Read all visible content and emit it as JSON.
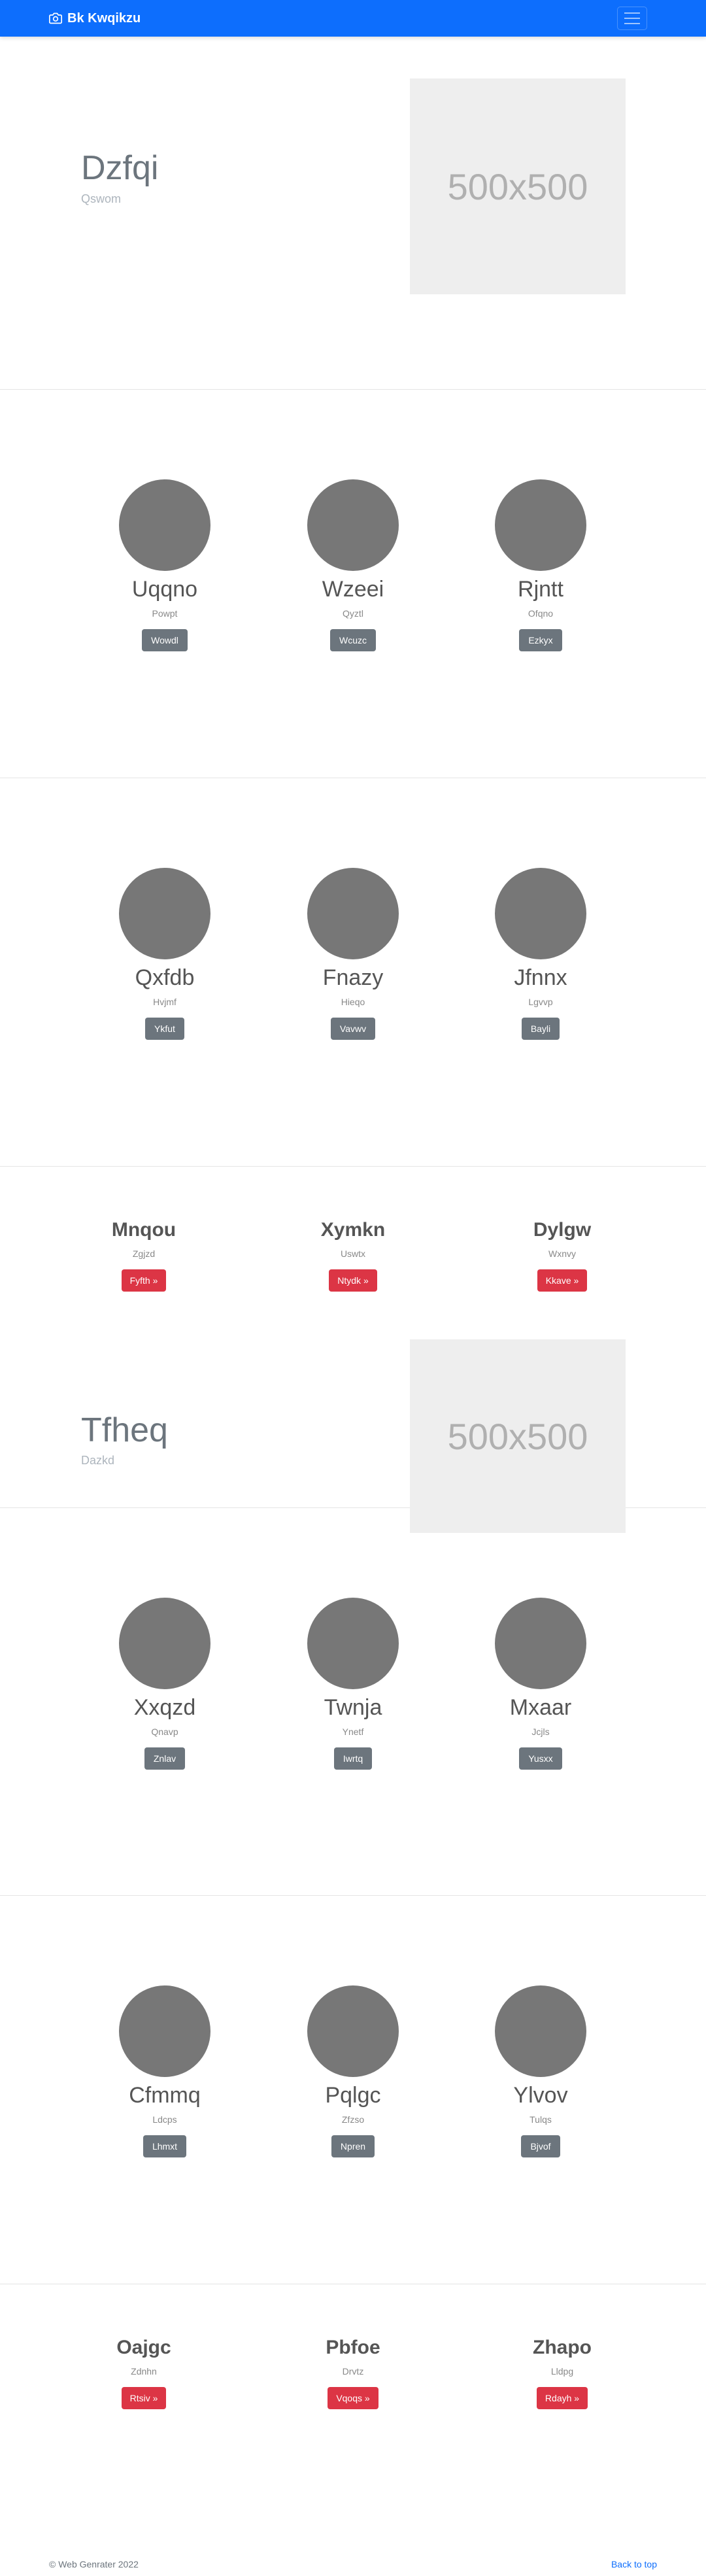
{
  "navbar": {
    "brand": "Bk Kwqikzu"
  },
  "hero1": {
    "title": "Dzfqi",
    "subtitle": "Qswom",
    "image_text": "500x500"
  },
  "people1": [
    {
      "name": "Uqqno",
      "sub": "Powpt",
      "button": "Wowdl"
    },
    {
      "name": "Wzeei",
      "sub": "Qyztl",
      "button": "Wcuzc"
    },
    {
      "name": "Rjntt",
      "sub": "Ofqno",
      "button": "Ezkyx"
    }
  ],
  "people2": [
    {
      "name": "Qxfdb",
      "sub": "Hvjmf",
      "button": "Ykfut"
    },
    {
      "name": "Fnazy",
      "sub": "Hieqo",
      "button": "Vavwv"
    },
    {
      "name": "Jfnnx",
      "sub": "Lgvvp",
      "button": "Bayli"
    }
  ],
  "features1": [
    {
      "name": "Mnqou",
      "sub": "Zgjzd",
      "button": "Fyfth »"
    },
    {
      "name": "Xymkn",
      "sub": "Uswtx",
      "button": "Ntydk »"
    },
    {
      "name": "Dylgw",
      "sub": "Wxnvy",
      "button": "Kkave »"
    }
  ],
  "hero2": {
    "title": "Tfheq",
    "subtitle": "Dazkd",
    "image_text": "500x500"
  },
  "people3": [
    {
      "name": "Xxqzd",
      "sub": "Qnavp",
      "button": "Znlav"
    },
    {
      "name": "Twnja",
      "sub": "Ynetf",
      "button": "Iwrtq"
    },
    {
      "name": "Mxaar",
      "sub": "Jcjls",
      "button": "Yusxx"
    }
  ],
  "people4": [
    {
      "name": "Cfmmq",
      "sub": "Ldcps",
      "button": "Lhmxt"
    },
    {
      "name": "Pqlgc",
      "sub": "Zfzso",
      "button": "Npren"
    },
    {
      "name": "Ylvov",
      "sub": "Tulqs",
      "button": "Bjvof"
    }
  ],
  "features2": [
    {
      "name": "Oajgc",
      "sub": "Zdnhn",
      "button": "Rtsiv »"
    },
    {
      "name": "Pbfoe",
      "sub": "Drvtz",
      "button": "Vqoqs »"
    },
    {
      "name": "Zhapo",
      "sub": "Lldpg",
      "button": "Rdayh »"
    }
  ],
  "footer": {
    "copyright": "© Web Genrater 2022",
    "back_to_top": "Back to top"
  },
  "colors": {
    "primary": "#0d6efd",
    "secondary": "#6c757d",
    "danger": "#dc3545",
    "avatar": "#777777",
    "placeholder": "#eeeeee"
  },
  "icons": {
    "brand": "camera-icon",
    "menu": "hamburger-icon"
  }
}
